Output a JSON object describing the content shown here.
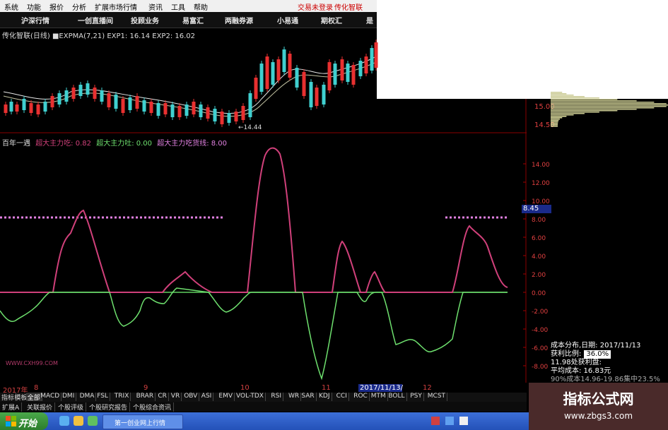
{
  "menu": {
    "items": [
      "系统",
      "功能",
      "报价",
      "分析",
      "扩展市场行情",
      "资讯",
      "工具",
      "帮助"
    ],
    "status_left": "交易未登录",
    "status_right": "传化智联"
  },
  "nav": {
    "items": [
      "沪深行情",
      "一创直播间",
      "投顾业务",
      "易富汇",
      "两融券源",
      "小易通",
      "期权汇",
      "是"
    ]
  },
  "kline": {
    "header": "传化智联(日线)  ■EXPMA(7,21) EXP1: 16.14  EXP2: 16.02",
    "low_label": "←14.44",
    "price_ticks": [
      "15.00",
      "14.50"
    ]
  },
  "indicator": {
    "name": "百年一遇",
    "series1": "超大主力吃: 0.82",
    "series2": "超大主力吐: 0.00",
    "series3": "超大主力吃货线: 8.00",
    "y_ticks": [
      "14.00",
      "12.00",
      "10.00",
      "8.00",
      "6.00",
      "4.00",
      "2.00",
      "0.00",
      "-2.00",
      "-4.00",
      "-6.00",
      "-8.00"
    ],
    "current_value": "8.45",
    "colors": {
      "buy": "#d0407a",
      "sell": "#6ee06e",
      "zero": "#5fd05f",
      "threshold": "#e080e0"
    }
  },
  "cost": {
    "title": "成本分布,日期: 2017/11/13",
    "ratio_label": "获利比例:",
    "ratio_value": "36.0%",
    "profit_line": "11.98处获利盘:",
    "avg_cost": "平均成本: 16.83元",
    "range": "90%成本14.96-19.86集中23.5%"
  },
  "dates": {
    "items": [
      "2017年",
      "8",
      "9",
      "10",
      "11",
      "12"
    ],
    "highlight": "2017/11/13/一"
  },
  "tabs": [
    "指标",
    "模板",
    "全部",
    "MACD",
    "DMI",
    "DMA",
    "FSL",
    "TRIX",
    "BRAR",
    "CR",
    "VR",
    "OBV",
    "ASI",
    "EMV",
    "VOL-TDX",
    "RSI",
    "WR",
    "SAR",
    "KDJ",
    "CCI",
    "ROC",
    "MTM",
    "BOLL",
    "PSY",
    "MCST"
  ],
  "subtabs": [
    "扩展A",
    "关联报价",
    "个股评级",
    "个股研究报告",
    "个股综合资讯"
  ],
  "site_watermark": "WWW.CXH99.COM",
  "taskbar": {
    "start": "开始",
    "task": "第一创业网上行情"
  },
  "brand_watermark": {
    "title": "指标公式网",
    "url": "www.zbgs3.com"
  }
}
